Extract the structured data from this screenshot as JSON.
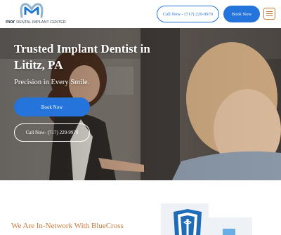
{
  "header": {
    "logo": {
      "brand": "mor",
      "tagline": "DENTAL IMPLANT CENTER"
    },
    "call_button": "Call Now - (717) 229-9970",
    "book_button": "Book Now",
    "menu_icon": "hamburger-menu-icon"
  },
  "hero": {
    "title": "Trusted Implant Dentist in Lititz, PA",
    "subtitle": "Precision in Every Smile.",
    "book_button": "Book Now",
    "call_button": "Call Now- (717) 229-9970"
  },
  "network": {
    "title": "We Are In-Network With BlueCross BlueShield Medical Insurance"
  },
  "colors": {
    "accent_blue": "#2474dc",
    "accent_copper": "#c77a3c",
    "logo_blue": "#1e78c8"
  }
}
